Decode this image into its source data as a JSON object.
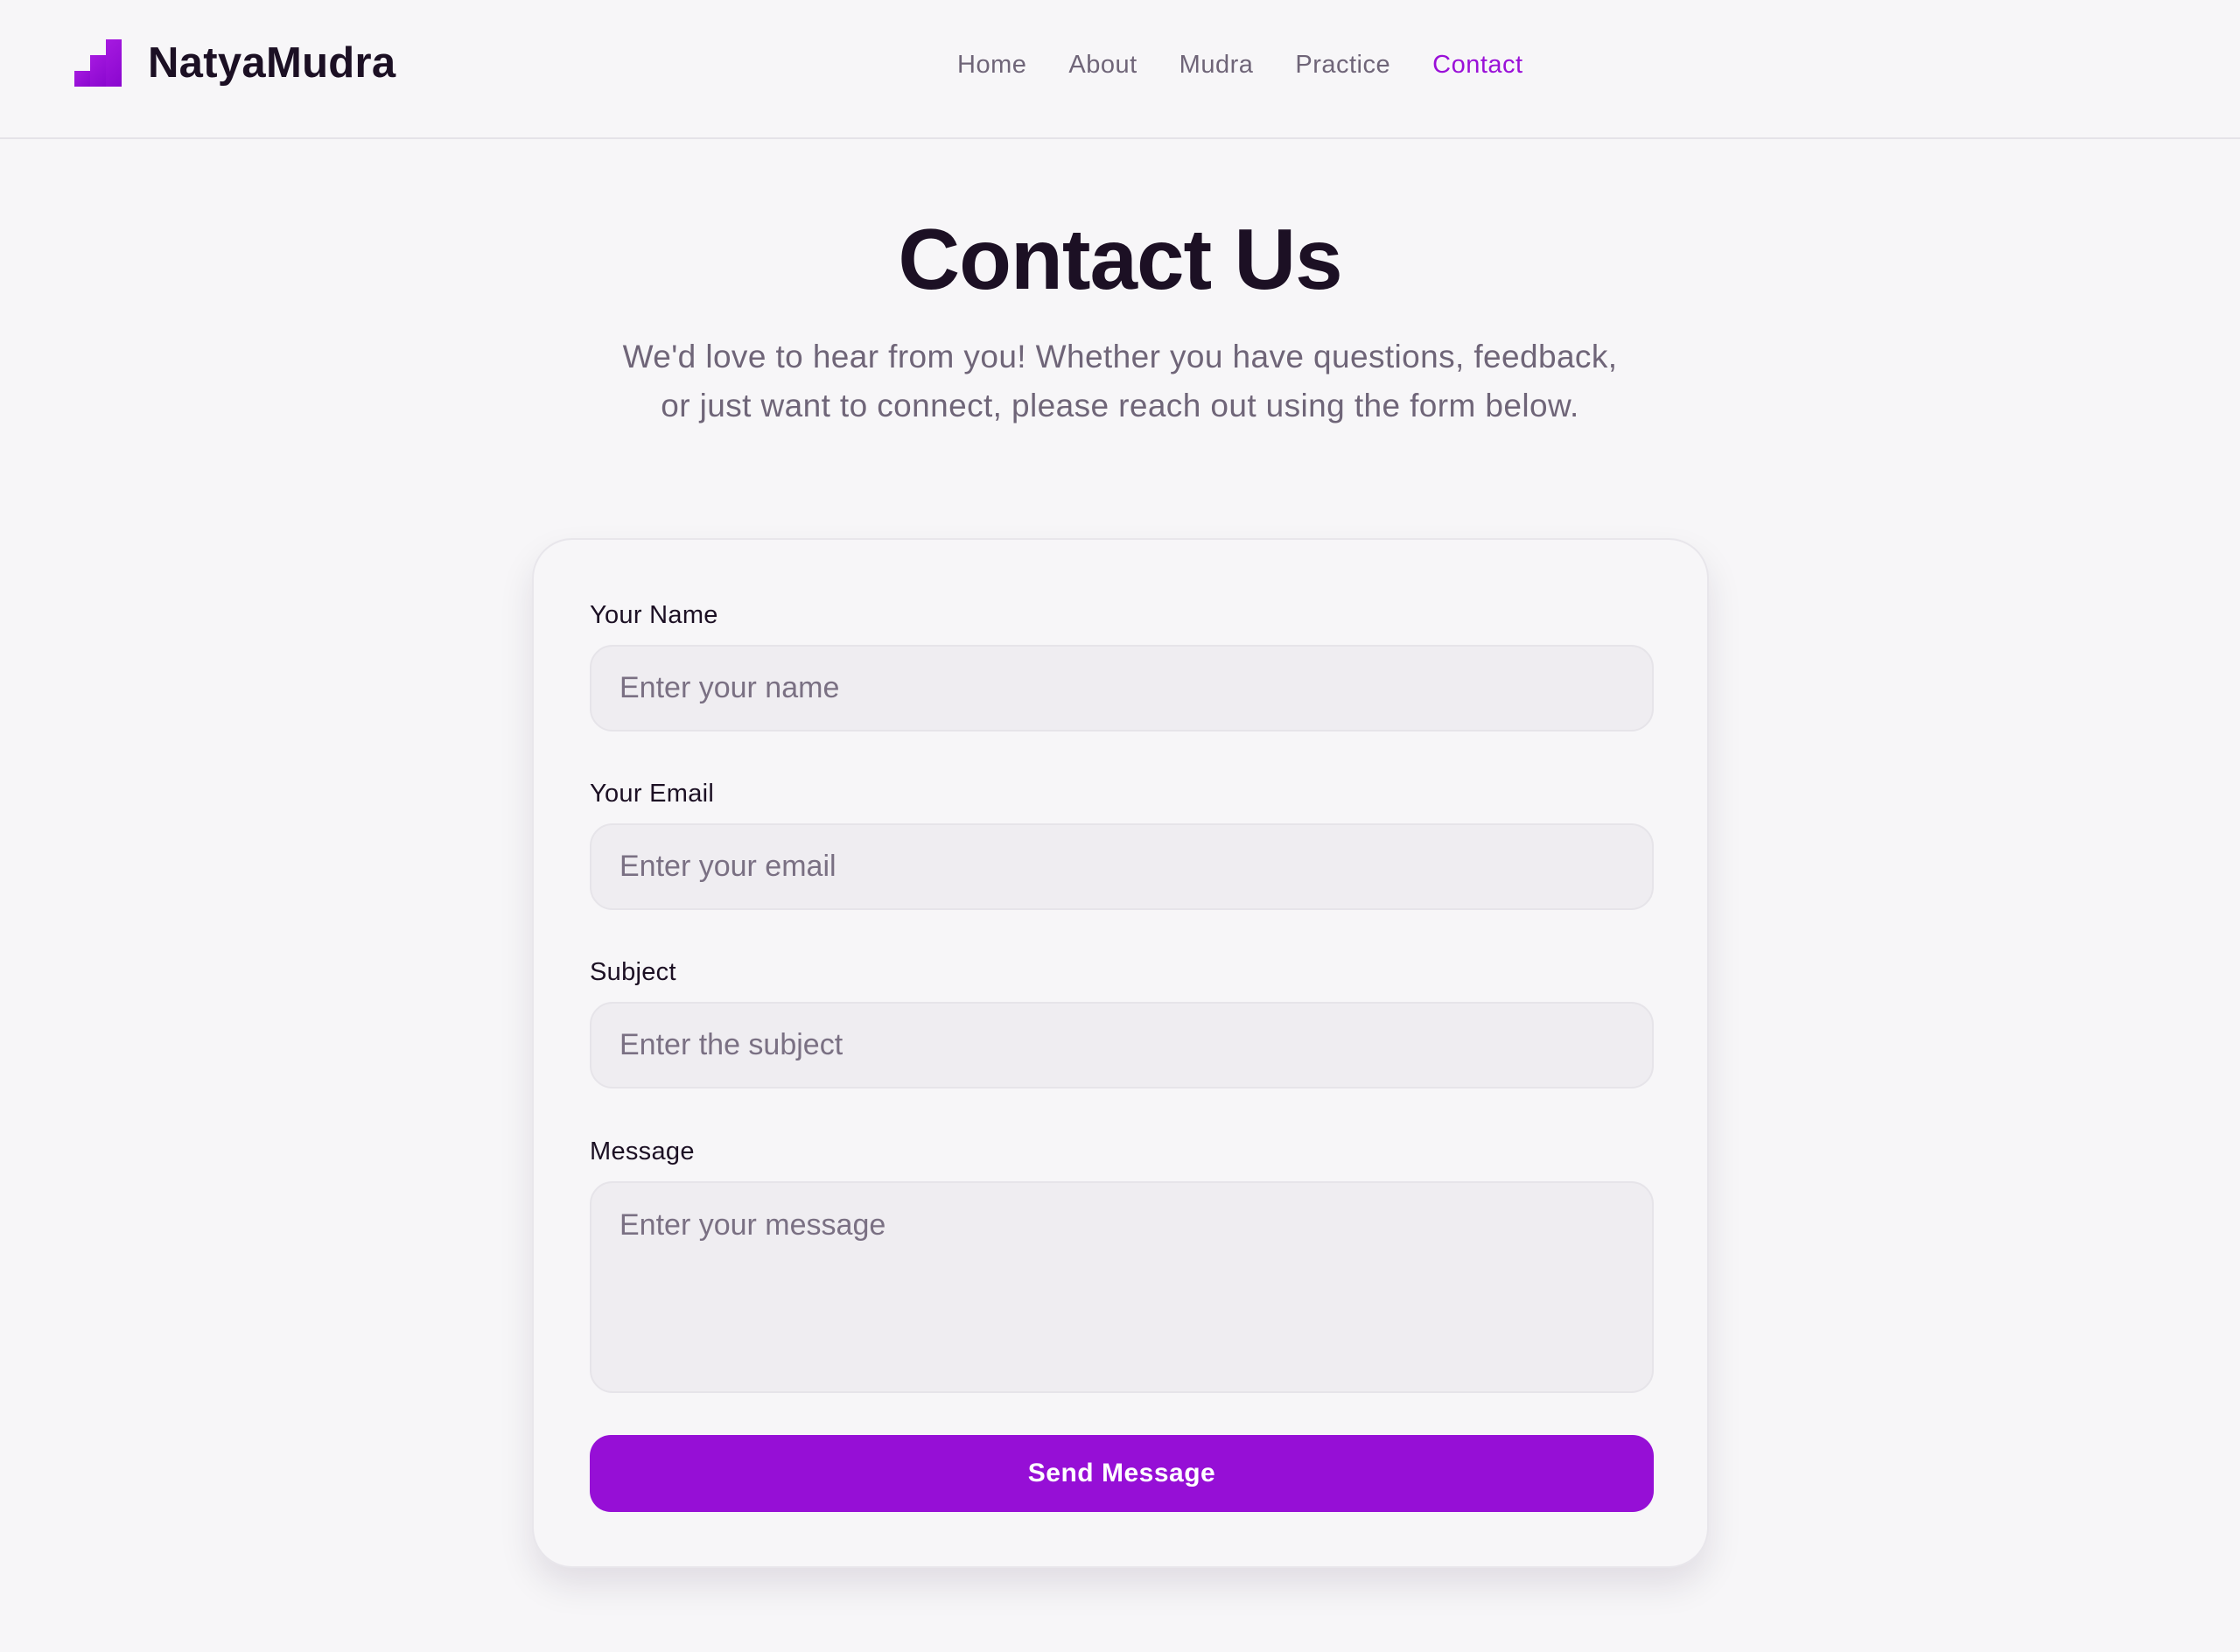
{
  "brand": {
    "name": "NatyaMudra",
    "logo_icon": "stairs-logo-icon",
    "accent_color": "#960fd6"
  },
  "nav": {
    "items": [
      {
        "label": "Home",
        "active": false
      },
      {
        "label": "About",
        "active": false
      },
      {
        "label": "Mudra",
        "active": false
      },
      {
        "label": "Practice",
        "active": false
      },
      {
        "label": "Contact",
        "active": true
      }
    ]
  },
  "page": {
    "title": "Contact Us",
    "subtitle": "We'd love to hear from you! Whether you have questions, feedback, or just want to connect, please reach out using the form below."
  },
  "form": {
    "name": {
      "label": "Your Name",
      "placeholder": "Enter your name",
      "value": ""
    },
    "email": {
      "label": "Your Email",
      "placeholder": "Enter your email",
      "value": ""
    },
    "subject": {
      "label": "Subject",
      "placeholder": "Enter the subject",
      "value": ""
    },
    "message": {
      "label": "Message",
      "placeholder": "Enter your message",
      "value": ""
    },
    "submit_label": "Send Message"
  }
}
